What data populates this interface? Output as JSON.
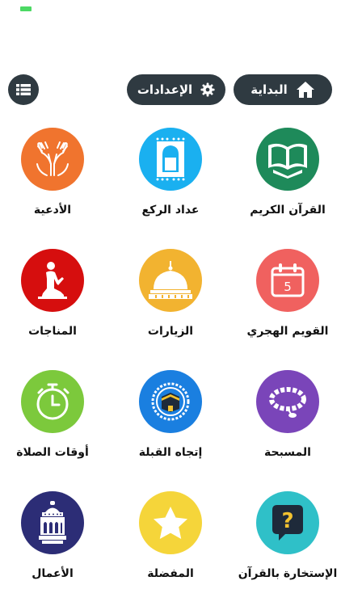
{
  "header": {
    "home_label": "البداية",
    "settings_label": "الإعدادات"
  },
  "grid": [
    {
      "label": "القرآن الكريم",
      "icon": "quran-icon",
      "color": "#1e8a5a"
    },
    {
      "label": "عداد الركع",
      "icon": "prayer-mat-icon",
      "color": "#1ab0f0"
    },
    {
      "label": "الأدعية",
      "icon": "praying-hands-icon",
      "color": "#f0742e"
    },
    {
      "label": "القويم الهجري",
      "icon": "calendar-icon",
      "color": "#f0615f",
      "calendar_day": "5"
    },
    {
      "label": "الزيارات",
      "icon": "dome-icon",
      "color": "#f2b330"
    },
    {
      "label": "المناجات",
      "icon": "praying-man-icon",
      "color": "#d60e0e"
    },
    {
      "label": "المسبحة",
      "icon": "prayer-beads-icon",
      "color": "#7a45b9"
    },
    {
      "label": "إتجاه القبلة",
      "icon": "kaaba-compass-icon",
      "color": "#1a7fe0"
    },
    {
      "label": "أوقات الصلاة",
      "icon": "stopwatch-icon",
      "color": "#7cc93c"
    },
    {
      "label": "الإستخارة بالقرآن",
      "icon": "question-bubble-icon",
      "color": "#2fc0c8"
    },
    {
      "label": "المفضلة",
      "icon": "star-icon",
      "color": "#f5d53a"
    },
    {
      "label": "الأعمال",
      "icon": "lantern-icon",
      "color": "#2c2d76"
    }
  ]
}
